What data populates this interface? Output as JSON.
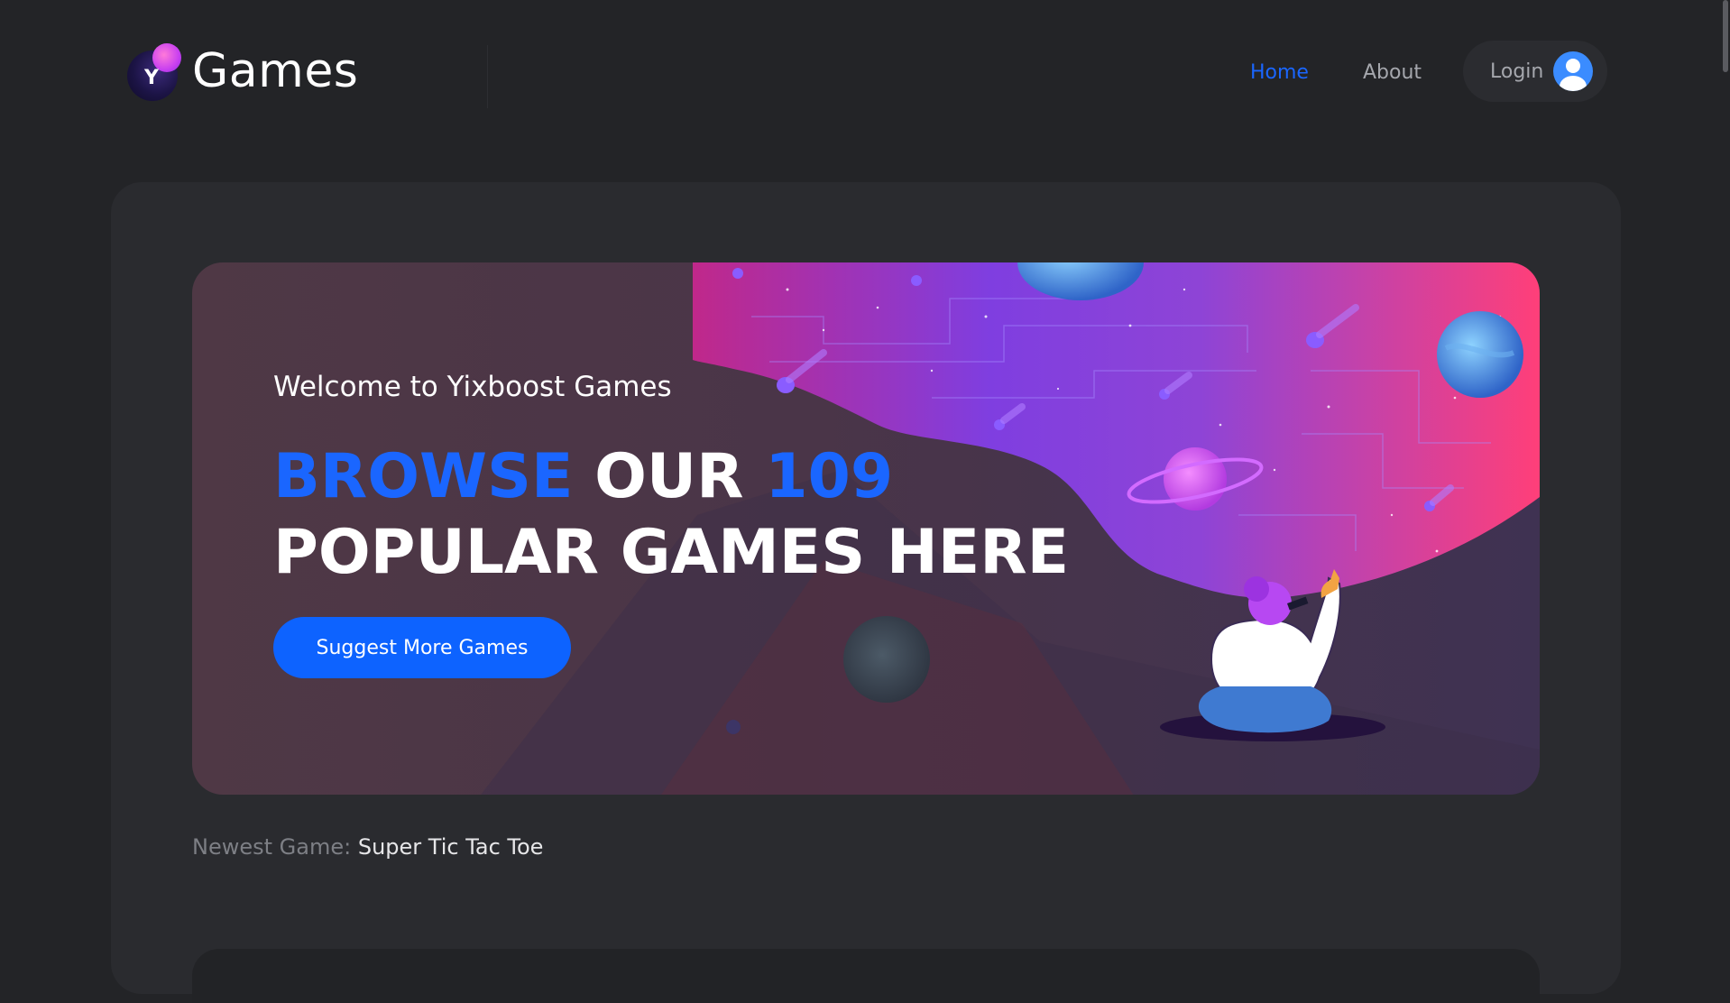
{
  "header": {
    "logo_text": "Games",
    "logo_letter": "Y",
    "nav": {
      "home_label": "Home",
      "about_label": "About",
      "login_label": "Login"
    }
  },
  "hero": {
    "welcome": "Welcome to Yixboost Games",
    "headline": {
      "word_browse": "BROWSE",
      "word_our": "OUR",
      "count": "109",
      "line2": "POPULAR GAMES HERE"
    },
    "button_label": "Suggest More Games"
  },
  "newest_game": {
    "label": "Newest Game:",
    "value": "Super Tic Tac Toe"
  },
  "colors": {
    "accent": "#1a66ff",
    "background": "#232427",
    "panel": "#2a2b2f",
    "button": "#0d63ff"
  },
  "icons": {
    "logo": "yixboost-logo-icon",
    "avatar": "user-avatar-icon",
    "hero_illustration": "space-illustration"
  }
}
